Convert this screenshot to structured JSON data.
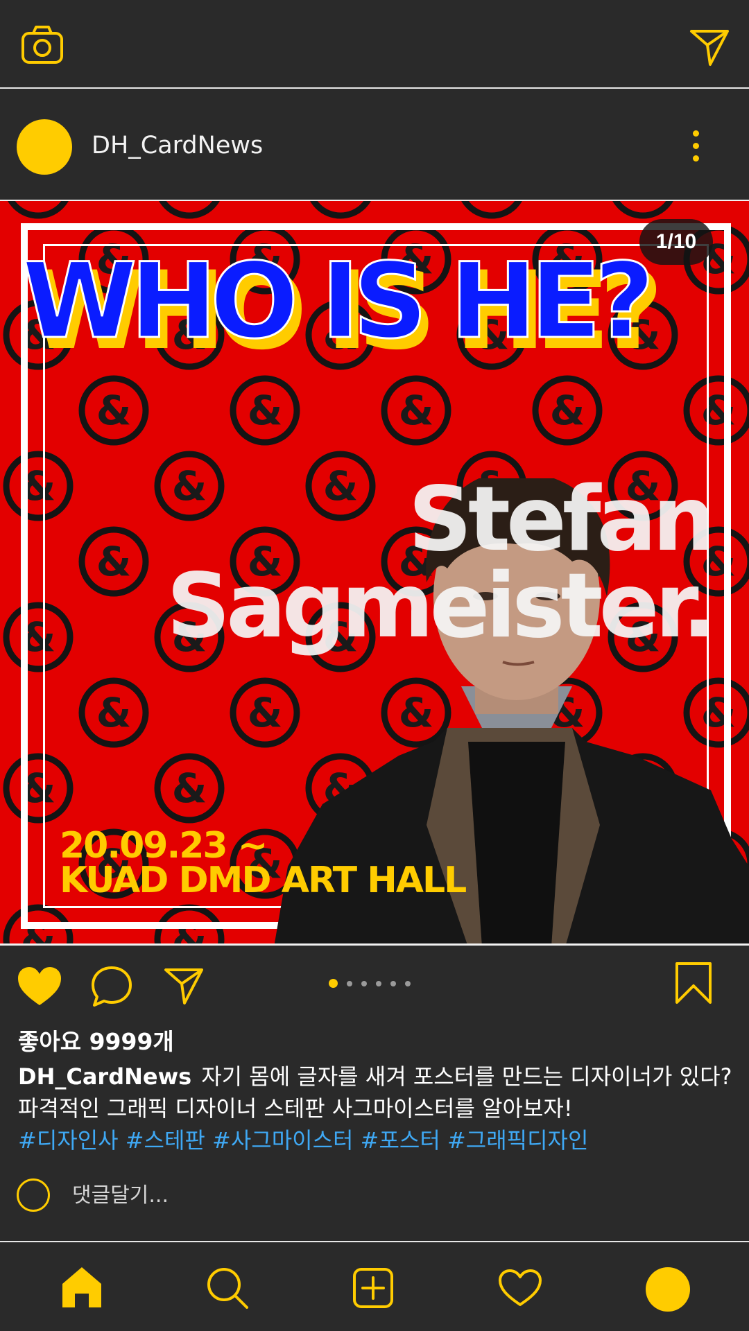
{
  "header": {
    "camera_icon": "camera-icon",
    "send_icon": "paper-plane-icon"
  },
  "post": {
    "username": "DH_CardNews",
    "more_icon": "more-vertical-icon",
    "counter": "1/10",
    "card": {
      "headline": "WHO IS HE?",
      "name_line1": "Stefan",
      "name_line2": "Sagmeister.",
      "date": "20.09.23 ~",
      "venue": "KUAD DMD ART HALL",
      "pattern_glyph": "&"
    },
    "carousel": {
      "total_dots": 6,
      "active_index": 0
    },
    "likes": "좋아요 9999개",
    "caption": {
      "author": "DH_CardNews",
      "line1": "자기 몸에 글자를 새겨 포스터를 만드는 디자이너가 있다?",
      "line2": "파격적인 그래픽 디자이너 스테판 사그마이스터를 알아보자!",
      "hashtags": "#디자인사 #스테판 #사그마이스터 #포스터 #그래픽디자인"
    },
    "comment": {
      "placeholder": "댓글달기..."
    }
  },
  "colors": {
    "accent": "#ffcc00",
    "background": "#2a2a2a",
    "card_red": "#e30000",
    "headline_blue": "#0a1cff",
    "hashtag": "#3fa9f5"
  },
  "nav": {
    "items": [
      "home-icon",
      "search-icon",
      "add-post-icon",
      "heart-icon",
      "profile-avatar"
    ]
  }
}
